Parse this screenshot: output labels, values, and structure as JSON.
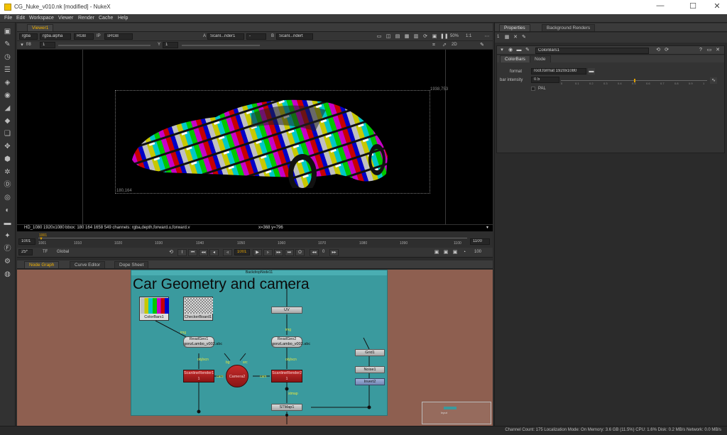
{
  "window": {
    "title": "CG_Nuke_v010.nk [modified] - NukeX",
    "minimize": "—",
    "maximize": "☐",
    "close": "✕"
  },
  "menu": [
    "File",
    "Edit",
    "Workspace",
    "Viewer",
    "Render",
    "Cache",
    "Help"
  ],
  "viewer_panel": {
    "tab": "Viewer1",
    "row1": {
      "channels": "rgba",
      "alpha": "rgba.alpha",
      "colorspace": "RGB",
      "ip": "IP",
      "lut": "sRGB",
      "a_label": "A",
      "a_input": "Scanl...nder1",
      "a_op": "-",
      "b_label": "B",
      "b_input": "Scanl...ndert",
      "zoom": "50%",
      "ratio": "1:1"
    },
    "row2": {
      "fstop": "f/8",
      "frame_field": "1",
      "y_label": "Y",
      "y_value": "1",
      "view_mode": "2D"
    },
    "overlay": {
      "top_right": "1938,753",
      "bottom_left": "180,164"
    },
    "info": {
      "format": "HD_1080 1920x1080",
      "bbox": "bbox: 180 164 1658 549 channels: rgba,depth,forward.u,forward.v",
      "coords": "x=368 y=796"
    }
  },
  "timeline": {
    "start_field": "1001",
    "end_field": "1100",
    "current": "1001",
    "ticks": [
      "1001",
      "1010",
      "1020",
      "1030",
      "1040",
      "1050",
      "1060",
      "1070",
      "1080",
      "1090",
      "1100"
    ]
  },
  "playbar": {
    "fps": "25*",
    "tf": "TF",
    "range": "Global",
    "frame": "1001",
    "increment": "0",
    "end": "100"
  },
  "bottom_tabs": [
    "Node Graph",
    "Curve Editor",
    "Dope Sheet"
  ],
  "nodegraph": {
    "backdrop_title": "BackdropNode11",
    "backdrop_label": "Car Geometry and camera",
    "nodes": {
      "colorbars": "ColorBars1",
      "checker": "CheckerBoard1",
      "readgeo1": "ReadGeo1",
      "readgeo1_file": "gonzLambo_v002.abc",
      "readgeo2": "ReadGeo2",
      "readgeo2_file": "gonzLambo_v002.abc",
      "uv": "UV",
      "scanline1": "ScanlineRender1",
      "scanline2": "ScanlineRender2",
      "camera": "Camera2",
      "grid": "Grid1",
      "noise": "Noise1",
      "invert": "Invert2",
      "stmap": "STMap1"
    },
    "pipes": {
      "img1": "img",
      "img2": "img",
      "obj_scn1": "obj/scn",
      "obj_scn2": "obj/scn",
      "cam1": "cam",
      "cam2": "cam",
      "bg": "bg",
      "src": "src",
      "stmap": "stmap",
      "mini": "Input"
    },
    "scanline_sub": "1"
  },
  "properties": {
    "tabs": [
      "Properties",
      "Background Renders"
    ],
    "count": "1",
    "node_name": "ColorBars1",
    "subtabs": [
      "ColorBars",
      "Node"
    ],
    "format_label": "format",
    "format_value": "root.format 1920x1080",
    "intensity_label": "bar intensity",
    "intensity_value": "0.5",
    "intensity_fraction": 0.5,
    "slider_ticks": [
      "0",
      "0.1",
      "0.2",
      "0.3",
      "0.4",
      "0.5",
      "0.6",
      "0.7",
      "0.8",
      "0.9",
      "1"
    ],
    "pal_label": "PAL"
  },
  "status": "Channel Count: 175  Localization Mode: On  Memory: 3.6 GB (11.5%)  CPU: 1.6%  Disk: 0.2 MB/s  Network: 0.0 MB/s"
}
